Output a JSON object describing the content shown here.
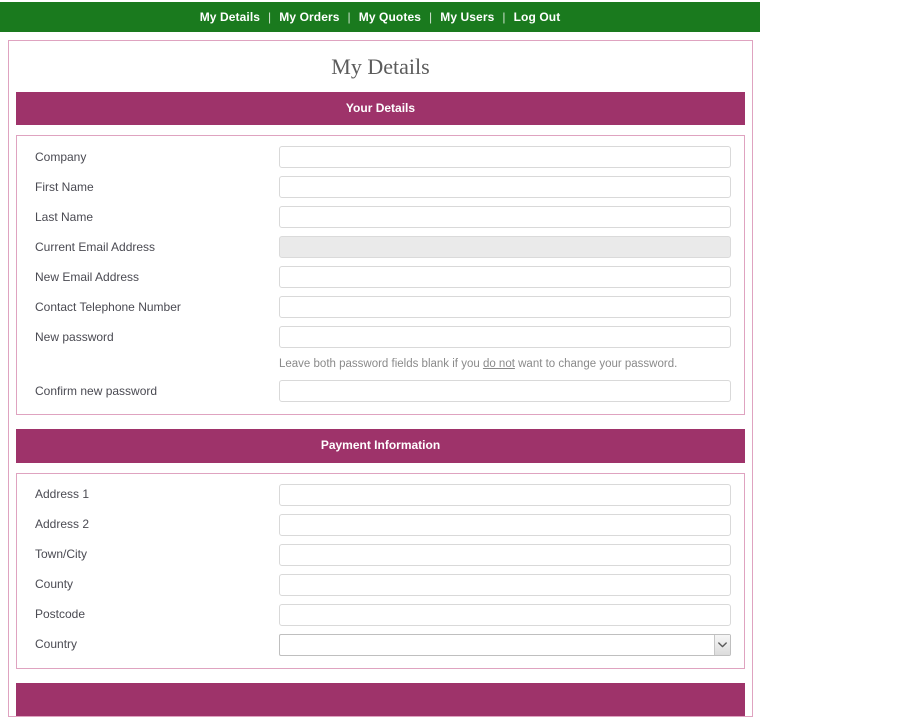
{
  "nav": {
    "separator": "|",
    "items": [
      {
        "label": "My Details",
        "name": "nav-my-details"
      },
      {
        "label": "My Orders",
        "name": "nav-my-orders"
      },
      {
        "label": "My Quotes",
        "name": "nav-my-quotes"
      },
      {
        "label": "My Users",
        "name": "nav-my-users"
      },
      {
        "label": "Log Out",
        "name": "nav-log-out"
      }
    ]
  },
  "page": {
    "title": "My Details"
  },
  "colors": {
    "nav_green": "#1a7a1e",
    "section_magenta": "#9e336a",
    "card_border_pink": "#dfa3c0",
    "input_border_gray": "#d9d9d9",
    "readonly_fill": "#eaeaea",
    "label_text": "#4a4a52",
    "title_text": "#5c5c5c",
    "hint_text": "#8a8a8a"
  },
  "sections": {
    "your_details": {
      "heading": "Your Details",
      "fields": [
        {
          "label": "Company",
          "value": "",
          "placeholder": "",
          "type": "text",
          "readonly": false
        },
        {
          "label": "First Name",
          "value": "",
          "placeholder": "",
          "type": "text",
          "readonly": false
        },
        {
          "label": "Last Name",
          "value": "",
          "placeholder": "",
          "type": "text",
          "readonly": false
        },
        {
          "label": "Current Email Address",
          "value": "",
          "placeholder": "",
          "type": "text",
          "readonly": true
        },
        {
          "label": "New Email Address",
          "value": "",
          "placeholder": "",
          "type": "text",
          "readonly": false
        },
        {
          "label": "Contact Telephone Number",
          "value": "",
          "placeholder": "",
          "type": "text",
          "readonly": false
        },
        {
          "label": "New password",
          "value": "",
          "placeholder": "",
          "type": "password",
          "readonly": false
        },
        {
          "label": "Confirm new password",
          "value": "",
          "placeholder": "",
          "type": "password",
          "readonly": false
        }
      ],
      "password_hint": {
        "before": "Leave both password fields blank if you ",
        "emphasis": "do not",
        "after": " want to change your password."
      }
    },
    "payment_information": {
      "heading": "Payment Information",
      "fields": [
        {
          "label": "Address 1",
          "value": "",
          "placeholder": "",
          "type": "text",
          "readonly": false
        },
        {
          "label": "Address 2",
          "value": "",
          "placeholder": "",
          "type": "text",
          "readonly": false
        },
        {
          "label": "Town/City",
          "value": "",
          "placeholder": "",
          "type": "text",
          "readonly": false
        },
        {
          "label": "County",
          "value": "",
          "placeholder": "",
          "type": "text",
          "readonly": false
        },
        {
          "label": "Postcode",
          "value": "",
          "placeholder": "",
          "type": "text",
          "readonly": false
        }
      ],
      "country": {
        "label": "Country",
        "selected": "",
        "options": [
          ""
        ]
      }
    },
    "third_section": {
      "heading": ""
    }
  },
  "icons": {
    "chevron_down": "chevron-down-icon"
  }
}
